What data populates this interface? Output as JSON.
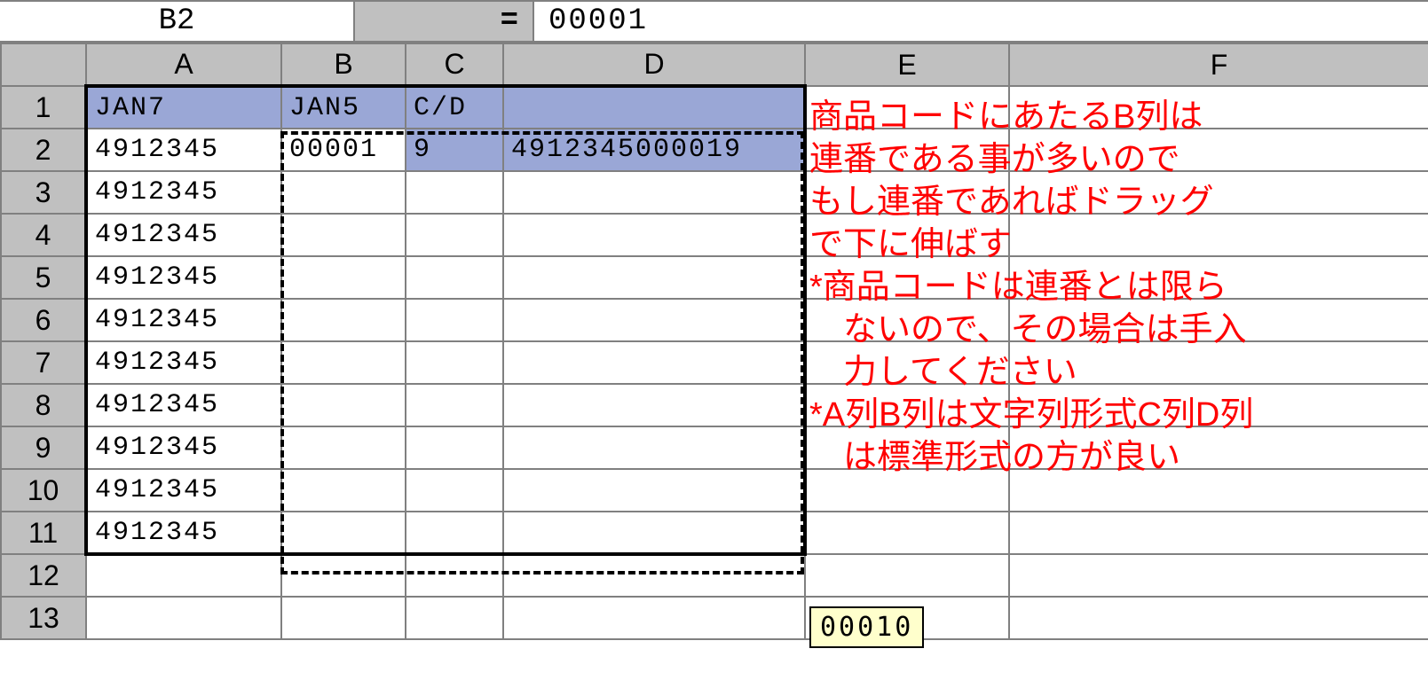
{
  "formula_bar": {
    "cell_ref": "B2",
    "value": "00001"
  },
  "columns": [
    "A",
    "B",
    "C",
    "D",
    "E",
    "F"
  ],
  "row_numbers": [
    "1",
    "2",
    "3",
    "4",
    "5",
    "6",
    "7",
    "8",
    "9",
    "10",
    "11",
    "12",
    "13"
  ],
  "headers": {
    "A": "JAN7",
    "B": "JAN5",
    "C": "C/D",
    "D": ""
  },
  "row2": {
    "A": "4912345",
    "B": "00001",
    "C": "9",
    "D": "4912345000019"
  },
  "colA_3_11": [
    "4912345",
    "4912345",
    "4912345",
    "4912345",
    "4912345",
    "4912345",
    "4912345",
    "4912345",
    "4912345"
  ],
  "drag_tooltip": "00010",
  "annotation": {
    "l1": "商品コードにあたるB列は",
    "l2": "連番である事が多いので",
    "l3": "もし連番であればドラッグ",
    "l4": "で下に伸ばす",
    "l5": "*商品コードは連番とは限ら",
    "l6": "ないので、その場合は手入",
    "l7": "力してください",
    "l8": "*A列B列は文字列形式C列D列",
    "l9": "は標準形式の方が良い"
  }
}
